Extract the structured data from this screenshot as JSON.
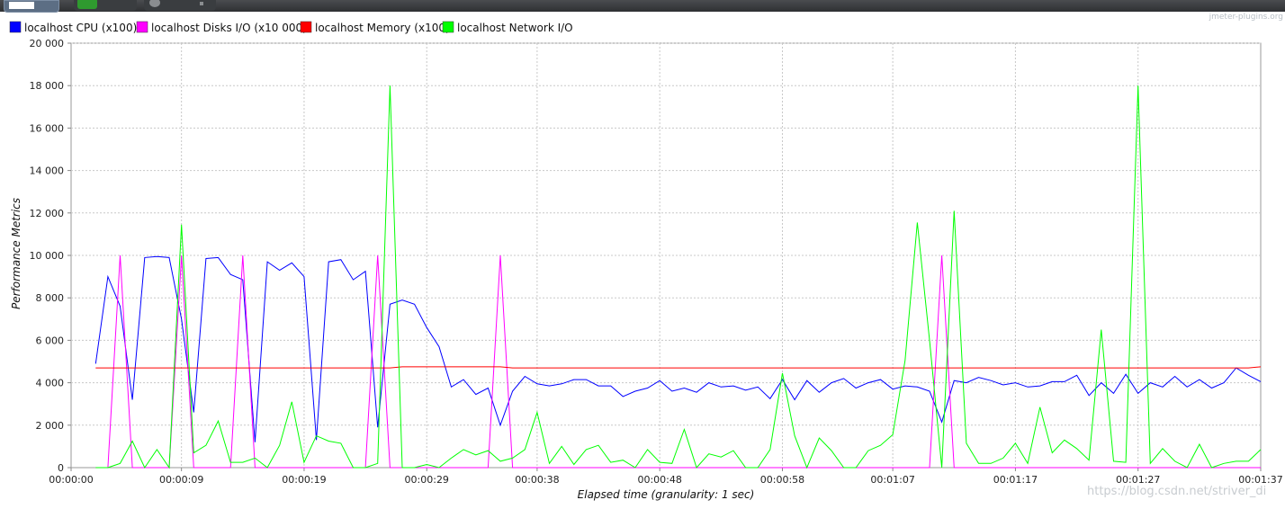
{
  "window": {
    "branding": "jmeter-plugins.org",
    "watermark": "https://blog.csdn.net/striver_di"
  },
  "chart_data": {
    "type": "line",
    "xlabel": "Elapsed time (granularity: 1 sec)",
    "ylabel": "Performance Metrics",
    "ylim": [
      0,
      20000
    ],
    "yticks": [
      "0",
      "2 000",
      "4 000",
      "6 000",
      "8 000",
      "10 000",
      "12 000",
      "14 000",
      "16 000",
      "18 000",
      "20 000"
    ],
    "xlim": [
      0,
      97
    ],
    "xticks": [
      {
        "t": 0,
        "label": "00:00:00"
      },
      {
        "t": 9,
        "label": "00:00:09"
      },
      {
        "t": 19,
        "label": "00:00:19"
      },
      {
        "t": 29,
        "label": "00:00:29"
      },
      {
        "t": 38,
        "label": "00:00:38"
      },
      {
        "t": 48,
        "label": "00:00:48"
      },
      {
        "t": 58,
        "label": "00:00:58"
      },
      {
        "t": 67,
        "label": "00:01:07"
      },
      {
        "t": 77,
        "label": "00:01:17"
      },
      {
        "t": 87,
        "label": "00:01:27"
      },
      {
        "t": 97,
        "label": "00:01:37"
      }
    ],
    "grid": true,
    "legend_position": "top-left",
    "x_start": 2,
    "series": [
      {
        "name": "localhost CPU (x100)",
        "color": "#0000ff",
        "values": [
          4900,
          9000,
          7600,
          3200,
          9900,
          9950,
          9900,
          7000,
          2600,
          9850,
          9900,
          9100,
          8850,
          1200,
          9700,
          9300,
          9650,
          9000,
          1300,
          9700,
          9800,
          8850,
          9250,
          1900,
          7700,
          7900,
          7700,
          6600,
          5700,
          3800,
          4150,
          3450,
          3750,
          2000,
          3600,
          4300,
          3950,
          3850,
          3950,
          4150,
          4150,
          3850,
          3850,
          3350,
          3600,
          3750,
          4100,
          3600,
          3750,
          3550,
          4000,
          3800,
          3850,
          3650,
          3800,
          3250,
          4150,
          3200,
          4100,
          3550,
          4000,
          4200,
          3750,
          4000,
          4150,
          3700,
          3850,
          3800,
          3600,
          2150,
          4100,
          4000,
          4250,
          4100,
          3900,
          4000,
          3800,
          3850,
          4050,
          4050,
          4350,
          3400,
          4000,
          3500,
          4400,
          3500,
          4000,
          3800,
          4300,
          3800,
          4150,
          3750,
          4000,
          4700,
          4350,
          4050
        ]
      },
      {
        "name": "localhost Disks I/O (x10 000)",
        "color": "#ff00ff",
        "values": [
          0,
          0,
          10000,
          0,
          0,
          0,
          0,
          10000,
          0,
          0,
          0,
          0,
          10000,
          0,
          0,
          0,
          0,
          0,
          0,
          0,
          0,
          0,
          0,
          10000,
          0,
          0,
          0,
          0,
          0,
          0,
          0,
          0,
          0,
          10000,
          0,
          0,
          0,
          0,
          0,
          0,
          0,
          0,
          0,
          0,
          0,
          0,
          0,
          0,
          0,
          0,
          0,
          0,
          0,
          0,
          0,
          0,
          0,
          0,
          0,
          0,
          0,
          0,
          0,
          0,
          0,
          0,
          0,
          0,
          0,
          10000,
          0,
          0,
          0,
          0,
          0,
          0,
          0,
          0,
          0,
          0,
          0,
          0,
          0,
          0,
          0,
          0,
          0,
          0,
          0,
          0,
          0,
          0,
          0,
          0,
          0,
          0
        ]
      },
      {
        "name": "localhost Memory (x100)",
        "color": "#ff0000",
        "values": [
          4700,
          4700,
          4700,
          4700,
          4700,
          4700,
          4700,
          4700,
          4700,
          4700,
          4700,
          4700,
          4700,
          4700,
          4700,
          4700,
          4700,
          4700,
          4700,
          4700,
          4700,
          4700,
          4700,
          4700,
          4700,
          4750,
          4750,
          4750,
          4750,
          4750,
          4750,
          4750,
          4750,
          4750,
          4700,
          4700,
          4700,
          4700,
          4700,
          4700,
          4700,
          4700,
          4700,
          4700,
          4700,
          4700,
          4700,
          4700,
          4700,
          4700,
          4700,
          4700,
          4700,
          4700,
          4700,
          4700,
          4700,
          4700,
          4700,
          4700,
          4700,
          4700,
          4700,
          4700,
          4700,
          4700,
          4700,
          4700,
          4700,
          4700,
          4700,
          4700,
          4700,
          4700,
          4700,
          4700,
          4700,
          4700,
          4700,
          4700,
          4700,
          4700,
          4700,
          4700,
          4700,
          4700,
          4700,
          4700,
          4700,
          4700,
          4700,
          4700,
          4700,
          4700,
          4700,
          4750
        ]
      },
      {
        "name": "localhost Network I/O",
        "color": "#00ff00",
        "values": [
          0,
          0,
          200,
          1250,
          0,
          850,
          0,
          11450,
          700,
          1050,
          2200,
          250,
          250,
          450,
          0,
          1050,
          3100,
          250,
          1500,
          1250,
          1150,
          0,
          0,
          200,
          18000,
          0,
          0,
          150,
          0,
          450,
          850,
          600,
          800,
          300,
          450,
          850,
          2600,
          200,
          1000,
          150,
          850,
          1050,
          250,
          350,
          0,
          850,
          250,
          200,
          1800,
          0,
          650,
          500,
          800,
          0,
          0,
          850,
          4450,
          1500,
          0,
          1400,
          800,
          0,
          0,
          800,
          1050,
          1550,
          5050,
          11550,
          6000,
          0,
          12100,
          1150,
          200,
          200,
          450,
          1150,
          200,
          2850,
          700,
          1300,
          900,
          350,
          6500,
          300,
          250,
          18000,
          200,
          900,
          300,
          0,
          1100,
          0,
          200,
          300,
          300,
          850
        ]
      }
    ],
    "legend": [
      {
        "name": "localhost CPU (x100)",
        "color": "#0000ff"
      },
      {
        "name": "localhost Disks I/O (x10 000)",
        "color": "#ff00ff"
      },
      {
        "name": "localhost Memory (x100)",
        "color": "#ff0000"
      },
      {
        "name": "localhost Network I/O",
        "color": "#00ff00"
      }
    ]
  }
}
